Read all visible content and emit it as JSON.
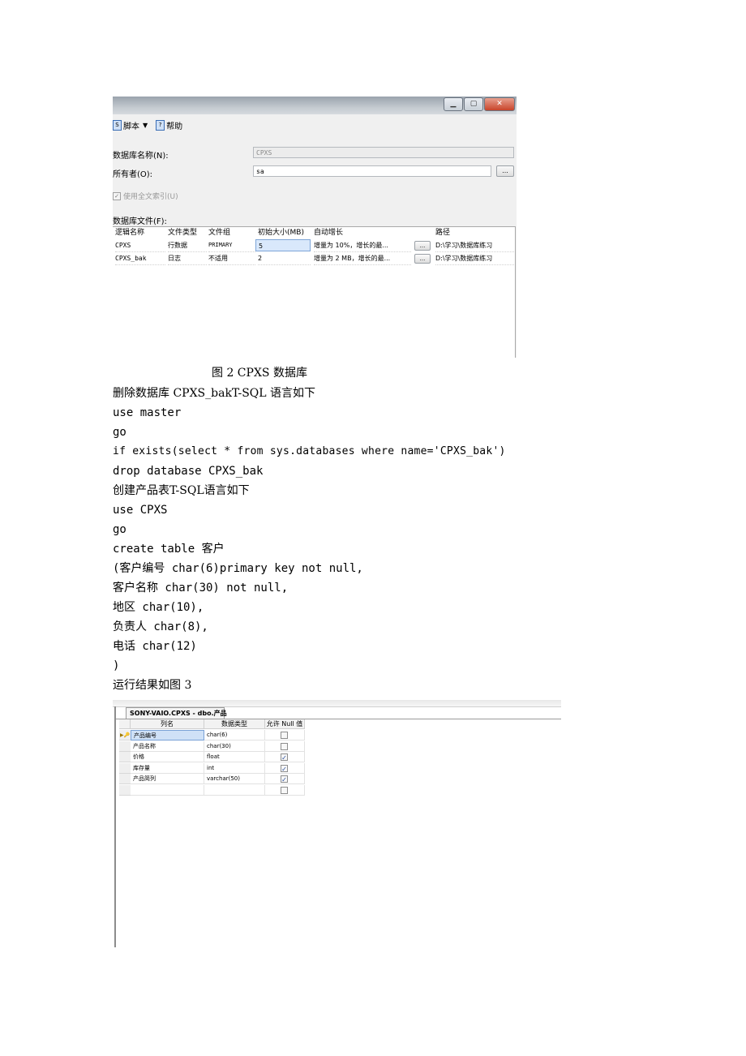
{
  "dialog": {
    "window_buttons": [
      "▁",
      "▢",
      "✕"
    ],
    "toolbar": {
      "script_label": "脚本",
      "help_label": "帮助"
    },
    "db_name_label": "数据库名称(N):",
    "db_name_value": "CPXS",
    "owner_label": "所有者(O):",
    "owner_value": "sa",
    "browse_label": "...",
    "fulltext_label": "使用全文索引(U)",
    "files_label": "数据库文件(F):",
    "grid": {
      "headers": [
        "逻辑名称",
        "文件类型",
        "文件组",
        "初始大小(MB)",
        "自动增长",
        "路径"
      ],
      "rows": [
        [
          "CPXS",
          "行数据",
          "PRIMARY",
          "5",
          "增量为 10%，增长的最...",
          "D:\\学习\\数据库练习"
        ],
        [
          "CPXS_bak",
          "日志",
          "不适用",
          "2",
          "增量为 2 MB，增长的最...",
          "D:\\学习\\数据库练习"
        ]
      ]
    }
  },
  "document": {
    "caption": "图 2 CPXS 数据库",
    "lines": [
      "删除数据库 CPXS_bakT-SQL 语言如下",
      "use master",
      "go",
      "if exists(select * from sys.databases where name='CPXS_bak')",
      "drop database CPXS_bak",
      "创建产品表T-SQL语言如下",
      "use CPXS",
      "go",
      "create table 客户",
      "(客户编号 char(6)primary key not null,",
      "客户名称 char(30) not null,",
      "地区 char(10),",
      "负责人 char(8),",
      "电话 char(12)",
      ")",
      "运行结果如图 3"
    ]
  },
  "designer": {
    "tab_title": "SONY-VAIO.CPXS - dbo.产品",
    "headers": [
      "列名",
      "数据类型",
      "允许 Null 值"
    ],
    "rows": [
      {
        "name": "产品编号",
        "type": "char(6)",
        "nullable": false,
        "key": true
      },
      {
        "name": "产品名称",
        "type": "char(30)",
        "nullable": false,
        "key": false
      },
      {
        "name": "价格",
        "type": "float",
        "nullable": true,
        "key": false
      },
      {
        "name": "库存量",
        "type": "int",
        "nullable": true,
        "key": false
      },
      {
        "name": "产品简列",
        "type": "varchar(50)",
        "nullable": true,
        "key": false
      },
      {
        "name": "",
        "type": "",
        "nullable": false,
        "key": false
      }
    ],
    "key_marker": "▶🔑"
  }
}
